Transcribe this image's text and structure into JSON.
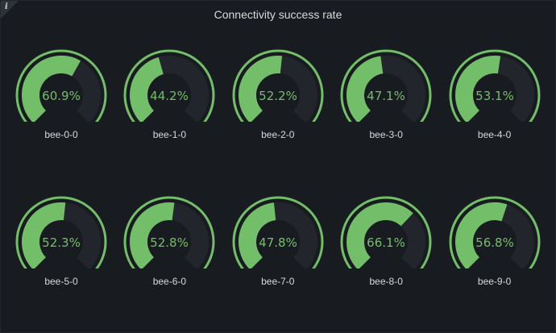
{
  "panel": {
    "title": "Connectivity success rate",
    "info_icon": "info-icon"
  },
  "colors": {
    "background": "#181b1f",
    "gauge_fill": "#73bf69",
    "gauge_track": "#22252b",
    "threshold": "#73bf69",
    "text": "#d8d9da"
  },
  "gauges": [
    {
      "label": "bee-0-0",
      "value": 60.9,
      "display": "60.9%"
    },
    {
      "label": "bee-1-0",
      "value": 44.2,
      "display": "44.2%"
    },
    {
      "label": "bee-2-0",
      "value": 52.2,
      "display": "52.2%"
    },
    {
      "label": "bee-3-0",
      "value": 47.1,
      "display": "47.1%"
    },
    {
      "label": "bee-4-0",
      "value": 53.1,
      "display": "53.1%"
    },
    {
      "label": "bee-5-0",
      "value": 52.3,
      "display": "52.3%"
    },
    {
      "label": "bee-6-0",
      "value": 52.8,
      "display": "52.8%"
    },
    {
      "label": "bee-7-0",
      "value": 47.8,
      "display": "47.8%"
    },
    {
      "label": "bee-8-0",
      "value": 66.1,
      "display": "66.1%"
    },
    {
      "label": "bee-9-0",
      "value": 56.8,
      "display": "56.8%"
    }
  ],
  "gauge_range": [
    0,
    100
  ]
}
